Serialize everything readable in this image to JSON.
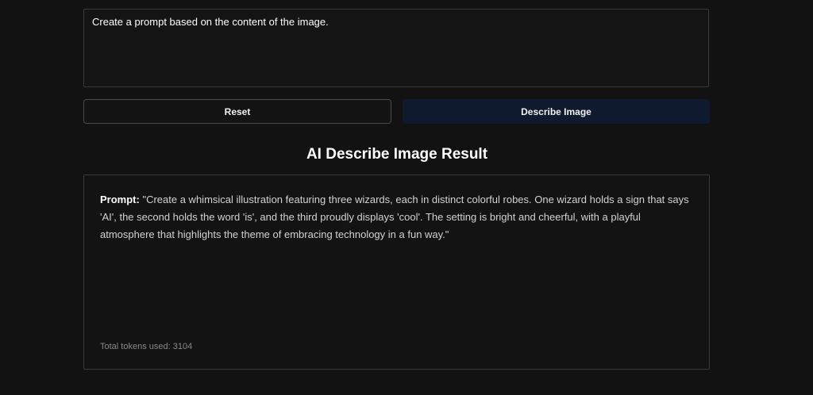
{
  "input": {
    "value": "Create a prompt based on the content of the image."
  },
  "buttons": {
    "reset_label": "Reset",
    "describe_label": "Describe Image"
  },
  "result": {
    "title": "AI Describe Image Result",
    "prompt_label": "Prompt:",
    "prompt_text": "\"Create a whimsical illustration featuring three wizards, each in distinct colorful robes. One wizard holds a sign that says 'AI', the second holds the word 'is', and the third proudly displays 'cool'. The setting is bright and cheerful, with a playful atmosphere that highlights the theme of embracing technology in a fun way.\"",
    "tokens": "Total tokens used: 3104"
  },
  "colors": {
    "background": "#121212",
    "describe_button": "#0f1a2e",
    "border": "#3a3a3a"
  }
}
